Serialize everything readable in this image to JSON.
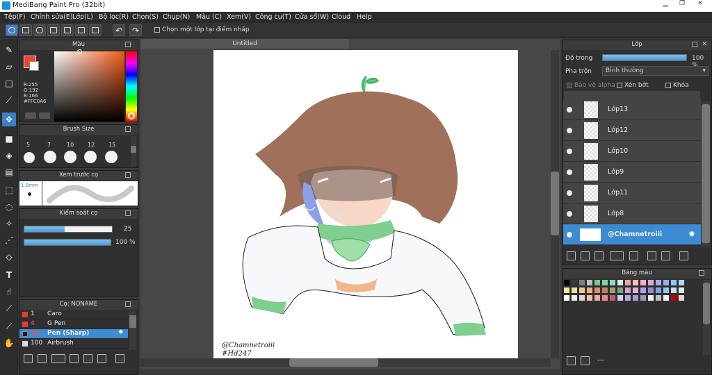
{
  "window": {
    "title": "MediBang Paint Pro (32bit)"
  },
  "menu": [
    "Tệp(F)",
    "Chỉnh sửa(E)",
    "Lớp(L)",
    "Bộ lọc(R)",
    "Chọn(S)",
    "Chụp(N)",
    "Màu (C)",
    "Xem(V)",
    "Công cụ(T)",
    "Cửa sổ(W)",
    "Cloud",
    "Help"
  ],
  "toolbar": {
    "checkbox_label": "Chọn một lớp tại điểm nhấp"
  },
  "color_panel": {
    "title": "Màu",
    "r": "R:255",
    "g": "G:192",
    "b": "B:166",
    "hex": "#FFC0A6",
    "primary": "#f2412c",
    "secondary": "#ffffff"
  },
  "brush_size": {
    "title": "Brush Size",
    "sizes": [
      "5",
      "7",
      "10",
      "12",
      "15"
    ]
  },
  "preview": {
    "title": "Xem trước cọ",
    "size": "1.8mm"
  },
  "control": {
    "title": "Kiểm soát cọ",
    "size_value": "25",
    "size_fraction": 0.46,
    "opacity_value": "100 %",
    "opacity_fraction": 1.0
  },
  "brush_list": {
    "title": "Cọ: NONAME",
    "items": [
      {
        "num": "1",
        "name": "Caro",
        "color": "#e04030",
        "selected": false
      },
      {
        "num": "4",
        "name": "G Pen",
        "color": "#e04030",
        "selected": false
      },
      {
        "num": "40",
        "name": "Pen (Sharp)",
        "color": "#1e1e1e",
        "selected": true
      },
      {
        "num": "100",
        "name": "Airbrush",
        "color": "#d8d8d8",
        "selected": false
      }
    ]
  },
  "canvas": {
    "tab": "Untitled",
    "sig1": "@Chamnetroiii",
    "sig2": "#Hd247"
  },
  "layer_panel": {
    "title": "Lớp",
    "opacity_label": "Độ trong",
    "opacity_value": "100 %",
    "opacity_fraction": 1.0,
    "blend_label": "Pha trộn",
    "blend_value": "Bình thường",
    "protect_alpha": "Bảo vệ alpha",
    "clipping": "Xén bớt",
    "lock": "Khóa",
    "layers": [
      {
        "name": "Lớp13"
      },
      {
        "name": "Lớp12"
      },
      {
        "name": "Lớp10"
      },
      {
        "name": "Lớp9"
      },
      {
        "name": "Lớp11"
      },
      {
        "name": "Lớp8"
      },
      {
        "name": "@Chamnetroiii",
        "selected": true
      }
    ]
  },
  "palette": {
    "title": "Bảng màu",
    "footer": "---",
    "colors": [
      "#000000",
      "#3a3a3a",
      "#808080",
      "#c0c0c0",
      "#6fd08a",
      "#7ad6a0",
      "#8fdbc0",
      "#d8f0e0",
      "#f6a0a0",
      "#f8c0c0",
      "#f0b0d0",
      "#d8a8e8",
      "#a8a8f0",
      "#90b0f0",
      "#90c8f0",
      "#b0d8f0",
      "#f0f0a0",
      "#e8e0a0",
      "#f0c890",
      "#f0b080",
      "#d89070",
      "#c08060",
      "#a0a070",
      "#80a080",
      "#d0a0d0",
      "#e0b0e0",
      "#b0a0e0",
      "#9090d0",
      "#80a0e0",
      "#a0c0f0",
      "#c0e0f0",
      "#e0f0f0",
      "#ffffff",
      "#f0f0f0",
      "#e8d0d0",
      "#f0c0a0",
      "#f0a8a8",
      "#e88888",
      "#c06060",
      "#d0d0f0",
      "#b0b0e0",
      "#a0a0c8",
      "#9898b8",
      "#f0f0f0",
      "#c0c0c0",
      "#f0f0f0",
      "#c00000",
      "#f0d0d0",
      "#e0b8b8",
      "#d0a0a0"
    ]
  }
}
